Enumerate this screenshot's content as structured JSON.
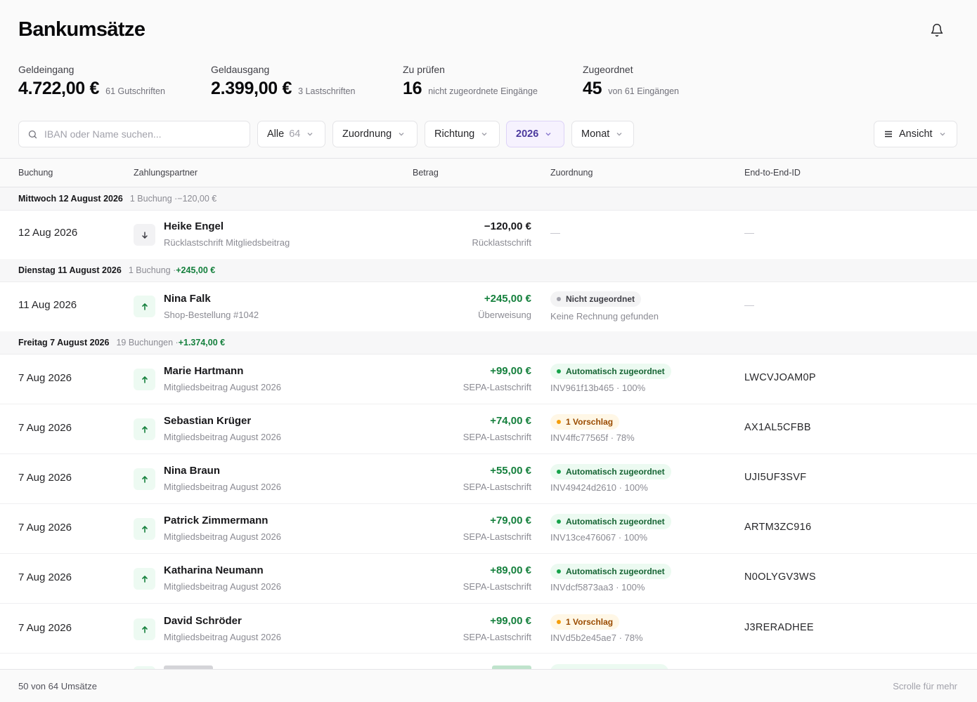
{
  "header": {
    "title": "Bankumsätze",
    "bell_icon": "bell-icon"
  },
  "stats": [
    {
      "label": "Geldeingang",
      "value": "4.722,00 €",
      "sub": "61 Gutschriften"
    },
    {
      "label": "Geldausgang",
      "value": "2.399,00 €",
      "sub": "3 Lastschriften"
    },
    {
      "label": "Zu prüfen",
      "value": "16",
      "sub": "nicht zugeordnete Eingänge"
    },
    {
      "label": "Zugeordnet",
      "value": "45",
      "sub": "von 61 Eingängen"
    }
  ],
  "toolbar": {
    "search_placeholder": "IBAN oder Name suchen...",
    "alle_label": "Alle",
    "alle_count": "64",
    "zuordnung_label": "Zuordnung",
    "richtung_label": "Richtung",
    "year_label": "2026",
    "monat_label": "Monat",
    "ansicht_label": "Ansicht"
  },
  "columns": {
    "buchung": "Buchung",
    "zahlungspartner": "Zahlungspartner",
    "betrag": "Betrag",
    "zuordnung": "Zuordnung",
    "e2e": "End-to-End-ID"
  },
  "groups": [
    {
      "date": "Mittwoch 12 August 2026",
      "meta": "1 Buchung · ",
      "sum": "−120,00 €"
    },
    {
      "date": "Dienstag 11 August 2026",
      "meta": "1 Buchung · ",
      "sum": "+245,00 €"
    },
    {
      "date": "Freitag 7 August 2026",
      "meta": "19 Buchungen · ",
      "sum": "+1.374,00 €"
    }
  ],
  "rows": [
    {
      "date": "12 Aug 2026",
      "name": "Heike Engel",
      "purpose": "Rücklastschrift Mitgliedsbeitrag",
      "amount": "−120,00 €",
      "method": "Rücklastschrift",
      "badge": "",
      "invoice": "",
      "e2e": "",
      "dash": "—"
    },
    {
      "date": "11 Aug 2026",
      "name": "Nina Falk",
      "purpose": "Shop-Bestellung #1042",
      "amount": "+245,00 €",
      "method": "Überweisung",
      "badge": "Nicht zugeordnet",
      "invoice": "Keine Rechnung gefunden",
      "e2e": "",
      "dash": "—"
    },
    {
      "date": "7 Aug 2026",
      "name": "Marie Hartmann",
      "purpose": "Mitgliedsbeitrag August 2026",
      "amount": "+99,00 €",
      "method": "SEPA-Lastschrift",
      "badge": "Automatisch zugeordnet",
      "invoice": "INV961f13b465 · 100%",
      "e2e": "LWCVJOAM0P"
    },
    {
      "date": "7 Aug 2026",
      "name": "Sebastian Krüger",
      "purpose": "Mitgliedsbeitrag August 2026",
      "amount": "+74,00 €",
      "method": "SEPA-Lastschrift",
      "badge": "1 Vorschlag",
      "invoice": "INV4ffc77565f · 78%",
      "e2e": "AX1AL5CFBB"
    },
    {
      "date": "7 Aug 2026",
      "name": "Nina Braun",
      "purpose": "Mitgliedsbeitrag August 2026",
      "amount": "+55,00 €",
      "method": "SEPA-Lastschrift",
      "badge": "Automatisch zugeordnet",
      "invoice": "INV49424d2610 · 100%",
      "e2e": "UJI5UF3SVF"
    },
    {
      "date": "7 Aug 2026",
      "name": "Patrick Zimmermann",
      "purpose": "Mitgliedsbeitrag August 2026",
      "amount": "+79,00 €",
      "method": "SEPA-Lastschrift",
      "badge": "Automatisch zugeordnet",
      "invoice": "INV13ce476067 · 100%",
      "e2e": "ARTM3ZC916"
    },
    {
      "date": "7 Aug 2026",
      "name": "Katharina Neumann",
      "purpose": "Mitgliedsbeitrag August 2026",
      "amount": "+89,00 €",
      "method": "SEPA-Lastschrift",
      "badge": "Automatisch zugeordnet",
      "invoice": "INVdcf5873aa3 · 100%",
      "e2e": "N0OLYGV3WS"
    },
    {
      "date": "7 Aug 2026",
      "name": "David Schröder",
      "purpose": "Mitgliedsbeitrag August 2026",
      "amount": "+99,00 €",
      "method": "SEPA-Lastschrift",
      "badge": "1 Vorschlag",
      "invoice": "INVd5b2e45ae7 · 78%",
      "e2e": "J3RERADHEE"
    }
  ],
  "footer": {
    "count": "50 von 64 Umsätze",
    "hint": "Scrolle für mehr"
  },
  "colors": {
    "positive": "#15803d",
    "accent_year": "#4c3a9e",
    "badge_auto": "#16a34a",
    "badge_suggestion": "#f59e0b"
  }
}
